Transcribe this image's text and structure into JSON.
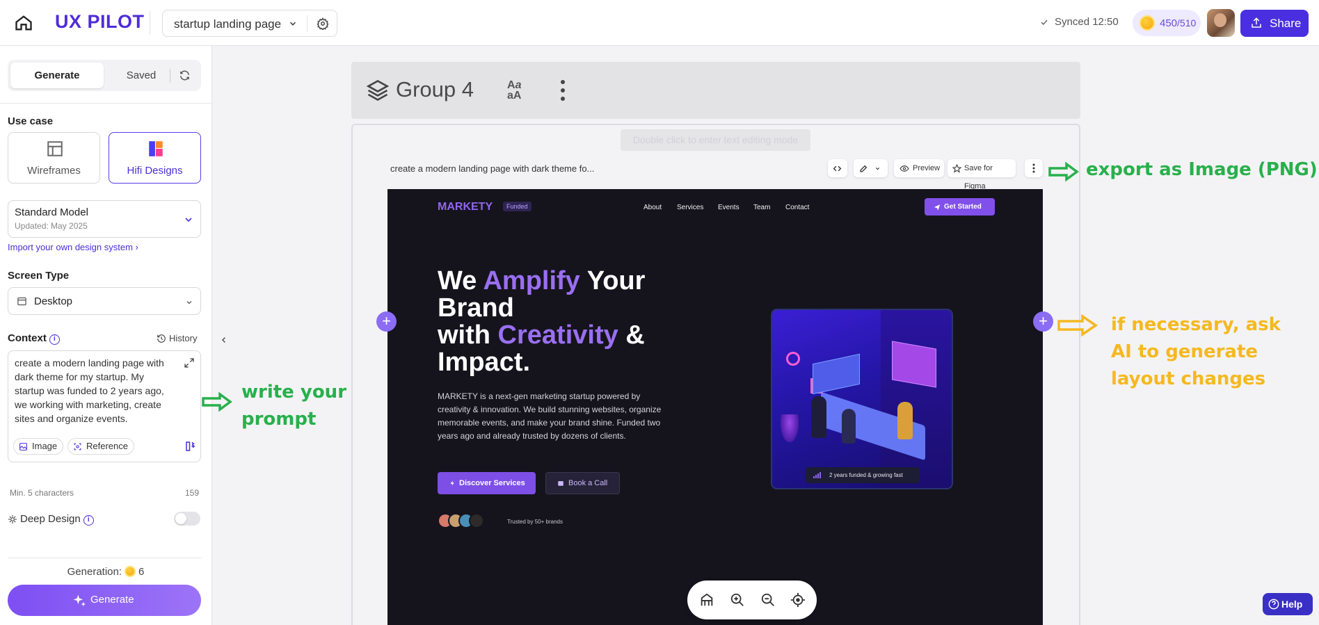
{
  "topbar": {
    "logo": "UX PILOT",
    "project": "startup landing page",
    "synced": "Synced 12:50",
    "credits_used": "450",
    "credits_total": "/510",
    "share": "Share"
  },
  "sidebar": {
    "tabs": {
      "generate": "Generate",
      "saved": "Saved"
    },
    "use_case_label": "Use case",
    "use_cases": [
      {
        "label": "Wireframes",
        "selected": false
      },
      {
        "label": "Hifi Designs",
        "selected": true
      }
    ],
    "model": {
      "name": "Standard Model",
      "updated": "Updated: May 2025"
    },
    "import_link": "Import your own design system",
    "screen_type_label": "Screen Type",
    "screen_type": "Desktop",
    "context_label": "Context",
    "history": "History",
    "context_text": "create a modern landing page with dark theme for my startup. My startup was funded to 2 years ago, we working with marketing, create sites and organize events.",
    "chips": {
      "image": "Image",
      "reference": "Reference"
    },
    "min_chars": "Min. 5 characters",
    "char_count": "159",
    "deep_design": "Deep Design",
    "generation_label": "Generation:",
    "generation_count": "6",
    "generate_button": "Generate"
  },
  "canvas": {
    "group_title": "Group 4",
    "tooltip": "Double click to enter text editing mode",
    "prompt": "create a modern landing page with dark theme fo...",
    "toolbar": {
      "preview": "Preview",
      "save_figma": "Save for Figma"
    },
    "site": {
      "brand": "MARKETY",
      "badge": "Funded",
      "nav": [
        "About",
        "Services",
        "Events",
        "Team",
        "Contact"
      ],
      "cta": "Get Started",
      "headline": {
        "l1a": "We ",
        "l1b": "Amplify",
        "l1c": " Your",
        "l2": "Brand",
        "l3a": "with ",
        "l3b": "Creativity",
        "l3c": " &",
        "l4": "Impact."
      },
      "description": "MARKETY is a next-gen marketing startup powered by creativity & innovation. We build stunning websites, organize memorable events, and make your brand shine. Funded two years ago and already trusted by dozens of clients.",
      "btn_primary": "Discover Services",
      "btn_secondary": "Book a Call",
      "trusted": "Trusted by 50+ brands",
      "hero_caption": "2 years funded & growing fast"
    }
  },
  "annotations": {
    "export": "export as Image (PNG)",
    "prompt": "write your prompt",
    "layout": "if necessary, ask AI to generate layout changes"
  },
  "help": "Help",
  "colors": {
    "accent": "#4a2fe0",
    "annotation_green": "#28b04c",
    "annotation_yellow": "#f5b820",
    "site_bg": "#15141d",
    "site_purple": "#8f66ef"
  }
}
